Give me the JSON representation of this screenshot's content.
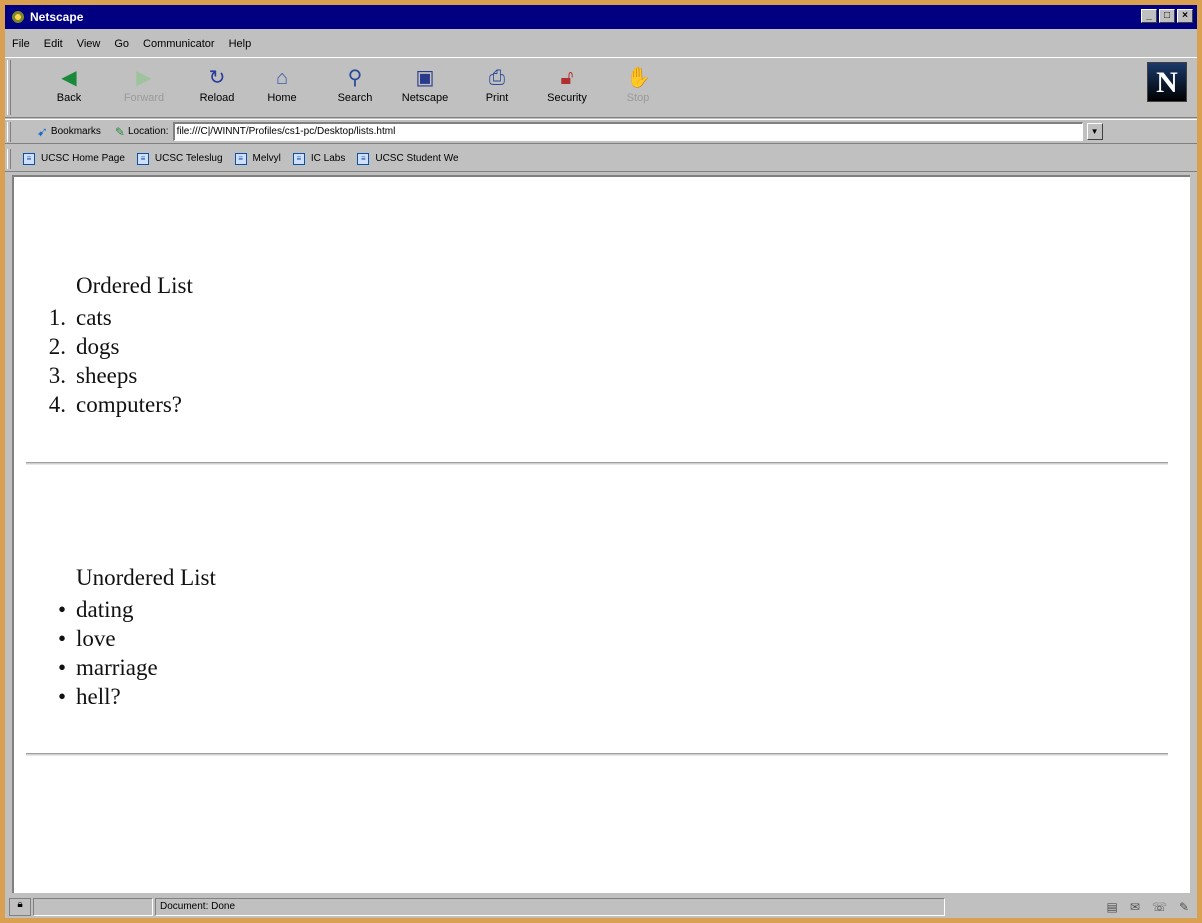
{
  "window": {
    "title": "Netscape"
  },
  "menu": [
    "File",
    "Edit",
    "View",
    "Go",
    "Communicator",
    "Help"
  ],
  "toolbar": {
    "buttons": [
      {
        "label": "Back",
        "icon": "back-arrow-icon",
        "disabled": false
      },
      {
        "label": "Forward",
        "icon": "forward-arrow-icon",
        "disabled": true
      },
      {
        "label": "Reload",
        "icon": "reload-icon",
        "disabled": false
      },
      {
        "label": "Home",
        "icon": "home-icon",
        "disabled": false
      },
      {
        "label": "Search",
        "icon": "search-icon",
        "disabled": false
      },
      {
        "label": "Netscape",
        "icon": "netscape-icon",
        "disabled": false
      },
      {
        "label": "Print",
        "icon": "print-icon",
        "disabled": false
      },
      {
        "label": "Security",
        "icon": "security-lock-icon",
        "disabled": false
      },
      {
        "label": "Stop",
        "icon": "stop-icon",
        "disabled": true
      }
    ],
    "logo": "N"
  },
  "location": {
    "bookmarks_label": "Bookmarks",
    "location_label": "Location:",
    "url": "file:///C|/WINNT/Profiles/cs1-pc/Desktop/lists.html"
  },
  "personal_toolbar": [
    "UCSC Home Page",
    "UCSC Teleslug",
    "Melvyl",
    "IC Labs",
    "UCSC Student We"
  ],
  "content": {
    "ordered": {
      "title": "Ordered List",
      "markers": [
        "1.",
        "2.",
        "3.",
        "4."
      ],
      "items": [
        "cats",
        "dogs",
        "sheeps",
        "computers?"
      ]
    },
    "unordered": {
      "title": "Unordered List",
      "marker": "•",
      "items": [
        "dating",
        "love",
        "marriage",
        "hell?"
      ]
    }
  },
  "status": {
    "text": "Document: Done"
  },
  "colors": {
    "titlebar": "#000080",
    "chrome": "#c0c0c0",
    "page": "#ffffff"
  }
}
